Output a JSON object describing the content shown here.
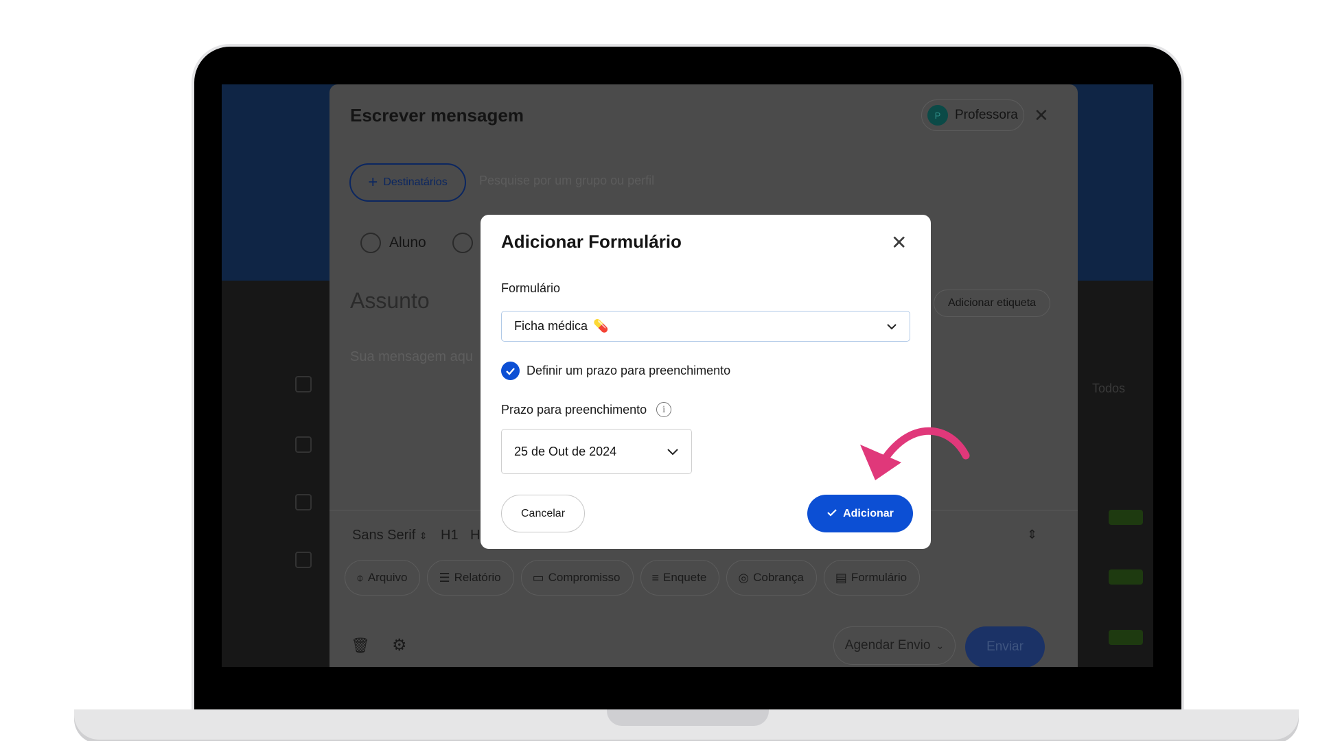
{
  "compose": {
    "title": "Escrever mensagem",
    "profile": {
      "initial": "P",
      "name": "Professora"
    },
    "recipients_button": "Destinatários",
    "search_placeholder": "Pesquise por um grupo ou perfil",
    "recipient_type": "Aluno",
    "subject_placeholder": "Assunto",
    "tag_button": "Adicionar etiqueta",
    "message_placeholder": "Sua mensagem aqu",
    "toolbar": {
      "font": "Sans Serif",
      "h1": "H1",
      "h2": "H"
    },
    "attachments": [
      {
        "label": "Arquivo",
        "icon": "paperclip-icon"
      },
      {
        "label": "Relatório",
        "icon": "list-icon"
      },
      {
        "label": "Compromisso",
        "icon": "calendar-icon"
      },
      {
        "label": "Enquete",
        "icon": "poll-icon"
      },
      {
        "label": "Cobrança",
        "icon": "money-icon"
      },
      {
        "label": "Formulário",
        "icon": "form-icon"
      }
    ],
    "schedule_button": "Agendar Envio",
    "send_button": "Enviar"
  },
  "background": {
    "side_label": "Todos"
  },
  "modal": {
    "title": "Adicionar Formulário",
    "form_label": "Formulário",
    "form_value": "Ficha médica",
    "deadline_checkbox_label": "Definir um prazo para preenchimento",
    "deadline_checked": true,
    "deadline_label": "Prazo para preenchimento",
    "deadline_value": "25 de Out de 2024",
    "cancel_button": "Cancelar",
    "add_button": "Adicionar"
  },
  "colors": {
    "primary": "#0c4fd4",
    "annotation_arrow": "#e0387a"
  }
}
